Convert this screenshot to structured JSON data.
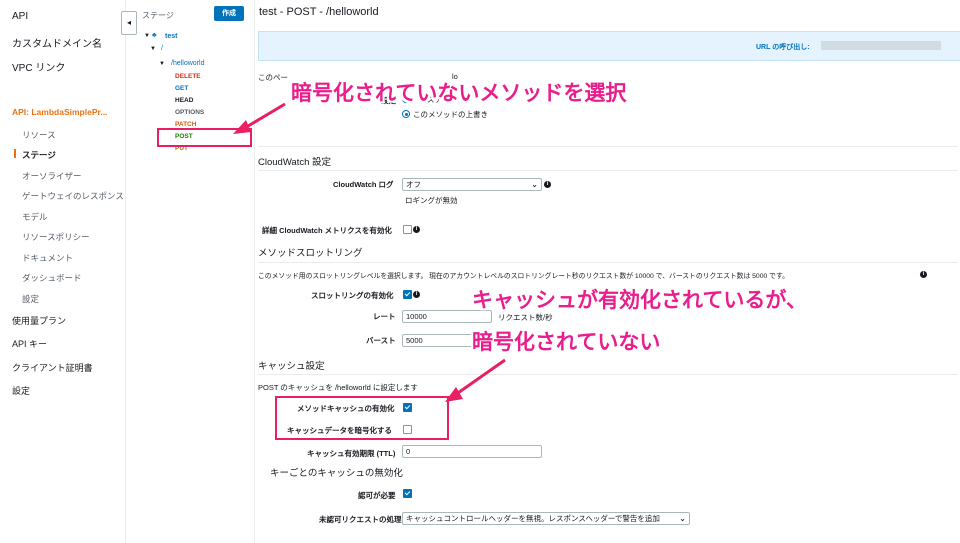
{
  "leftnav": {
    "items": [
      "API",
      "カスタムドメイン名",
      "VPC リンク"
    ],
    "api_label": "API: LambdaSimplePr...",
    "sub_items": [
      "リソース",
      "ステージ",
      "オーソライザー",
      "ゲートウェイのレスポンス",
      "モデル",
      "リソースポリシー",
      "ドキュメント",
      "ダッシュボード",
      "設定"
    ],
    "bottom_items": [
      "使用量プラン",
      "API キー",
      "クライアント証明書",
      "設定"
    ],
    "collapse_glyph": "◂"
  },
  "tree": {
    "title": "ステージ",
    "create_button": "作成",
    "stage": "test",
    "root": "/",
    "resource": "/helloworld",
    "methods": [
      "DELETE",
      "GET",
      "HEAD",
      "OPTIONS",
      "PATCH",
      "POST",
      "PUT"
    ],
    "method_colors": [
      "#d13212",
      "#0073bb",
      "#16191f",
      "#545b64",
      "#d45b07",
      "#1d8102",
      "#9b7a00"
    ]
  },
  "main": {
    "title": "test - POST - /helloworld",
    "url_label": "URL の呼び出し:",
    "partial_line_prefix": "このペー",
    "partial_line_suffix": "lo",
    "radio_settings_label": "設定",
    "radio_option_partial": "ステージ",
    "radio_option_override": "このメソッドの上書き",
    "cloudwatch_heading": "CloudWatch 設定",
    "cloudwatch_log_label": "CloudWatch ログ",
    "cloudwatch_log_value": "オフ",
    "logging_disabled": "ロギングが無効",
    "detail_metrics_label": "詳細 CloudWatch メトリクスを有効化",
    "throttling_heading": "メソッドスロットリング",
    "throttling_desc_a": "このメソッド用のスロットリングレベルを選択します。 現在の",
    "throttling_desc_b": "アカウントレベルのスロ",
    "throttling_desc_c": "トリングレート",
    "throttling_desc_d": "秒",
    "throttling_desc_e": "のリクエスト数",
    "throttling_desc_f": "が 10000 で、バーストのリクエスト数は 5000 です。",
    "throttling_enable_label": "スロットリングの有効化",
    "rate_label": "レート",
    "rate_value": "10000",
    "rate_unit": "リクエスト数/秒",
    "burst_label": "バースト",
    "burst_value": "5000",
    "cache_heading": "キャッシュ設定",
    "cache_desc": "POST のキャッシュを /helloworld に設定します",
    "method_cache_label": "メソッドキャッシュの有効化",
    "encrypt_cache_label": "キャッシュデータを暗号化する",
    "ttl_label": "キャッシュ有効期限 (TTL)",
    "ttl_value": "0",
    "invalidation_heading": "キーごとのキャッシュの無効化",
    "auth_required_label": "認可が必要",
    "unauth_label": "未認可リクエストの処理",
    "unauth_value": "キャッシュコントロールヘッダーを無視。レスポンスヘッダーで警告を追加",
    "info_glyph": "i"
  },
  "annotations": {
    "top": "暗号化されていないメソッドを選択",
    "middle_line1": "キャッシュが有効化されているが、",
    "middle_line2": "暗号化されていない",
    "color": "#e91e8c"
  }
}
